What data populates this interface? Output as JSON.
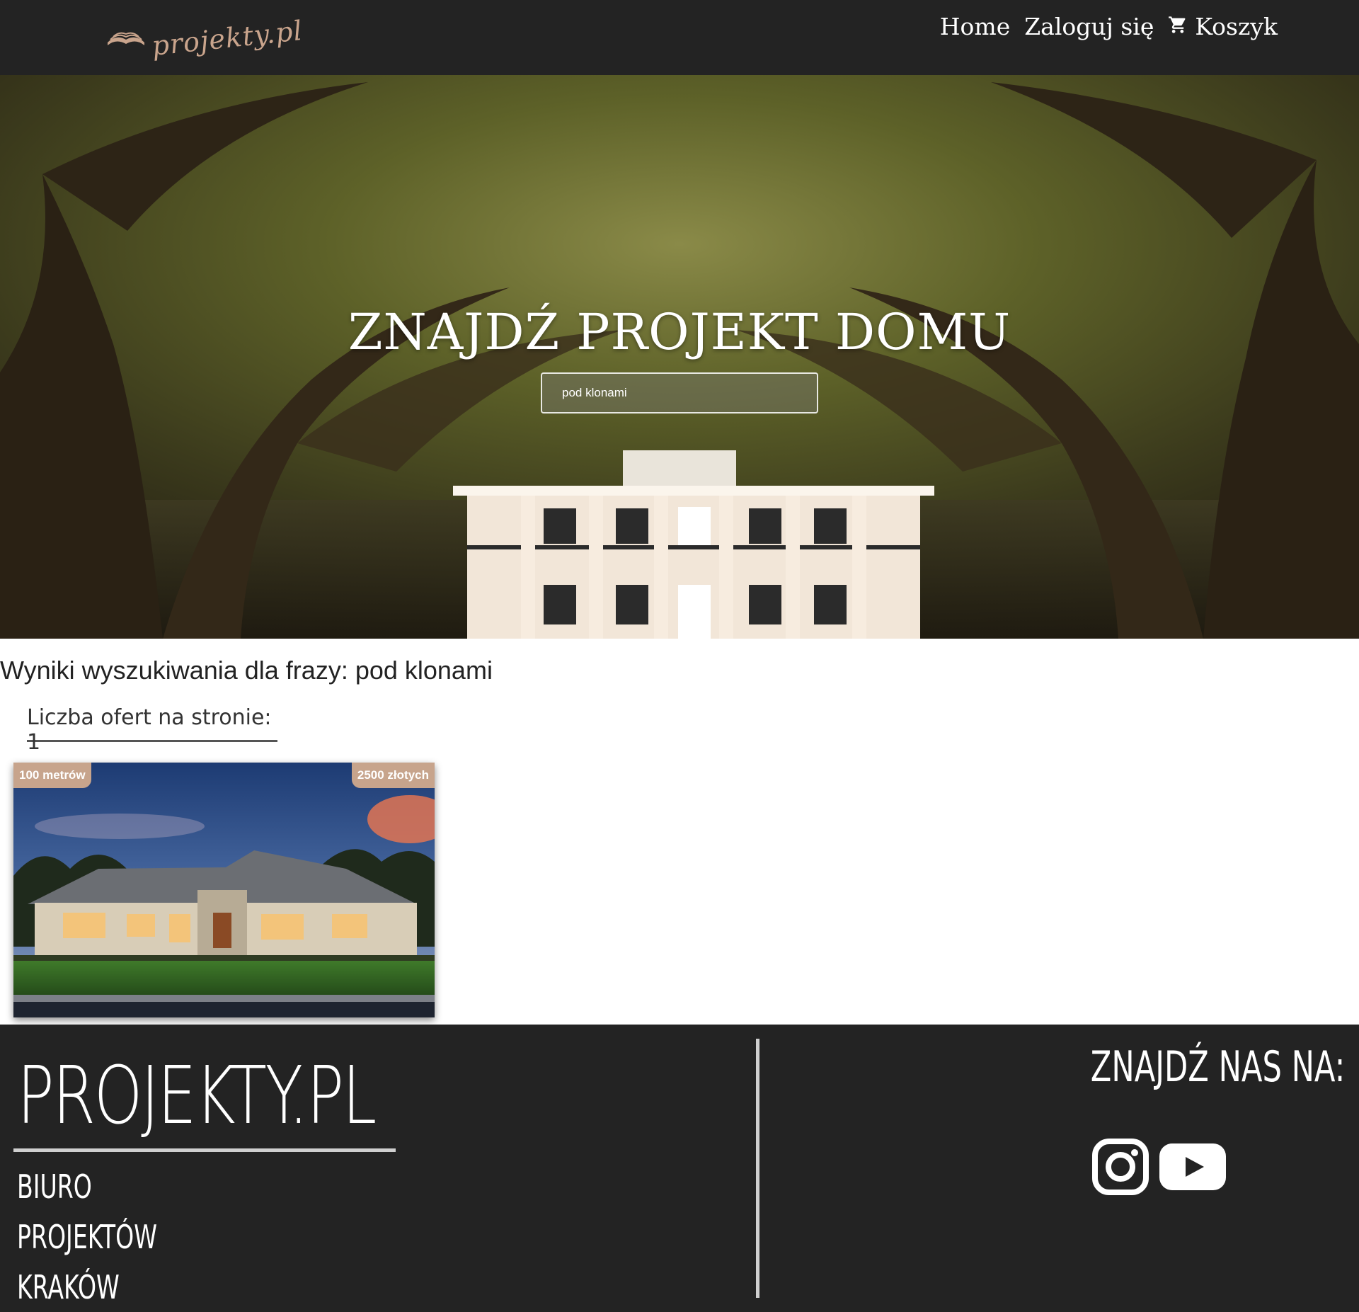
{
  "nav": {
    "logo_text": "projekty.pl",
    "links": [
      {
        "label": "Home"
      },
      {
        "label": "Zaloguj się"
      },
      {
        "label": "Koszyk"
      }
    ]
  },
  "hero": {
    "title": "ZNAJDŹ PROJEKT DOMU",
    "search_value": "pod klonami"
  },
  "results": {
    "heading": "Wyniki wyszukiwania dla frazy: pod klonami",
    "per_page_label": "Liczba ofert na stronie: 1",
    "cards": [
      {
        "area_badge": "100 metrów",
        "price_badge": "2500 złotych"
      }
    ]
  },
  "footer": {
    "brand": "PROJEKTY.PL",
    "lines": [
      "BIURO",
      "PROJEKTÓW",
      "KRAKÓW"
    ],
    "find_us": "ZNAJDŹ NAS NA:",
    "social_icons": [
      "instagram-icon",
      "youtube-icon"
    ]
  },
  "colors": {
    "navbar_bg": "#232323",
    "accent": "#c7a48c",
    "footer_bg": "#232323"
  }
}
